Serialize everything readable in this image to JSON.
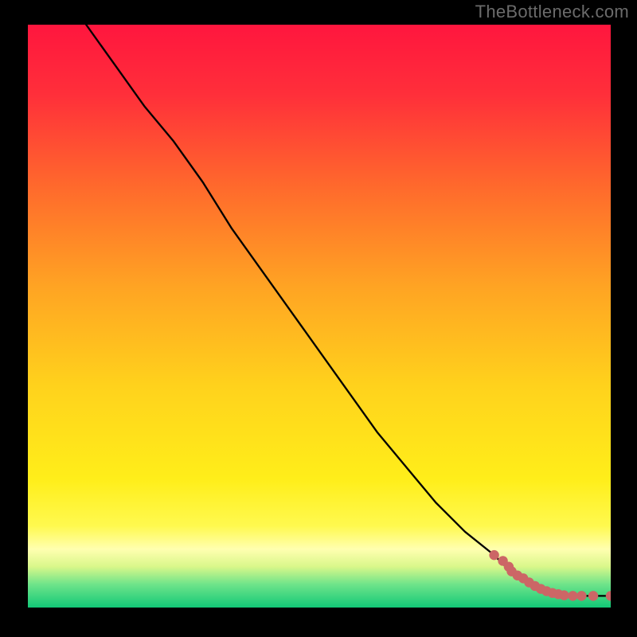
{
  "watermark": "TheBottleneck.com",
  "colors": {
    "background": "#000000",
    "watermark": "#6b6b6b",
    "curve": "#000000",
    "markers": "#cc6666",
    "gradient_top": "#ff1a3c",
    "gradient_mid1": "#ff8a1f",
    "gradient_mid2": "#ffe81a",
    "gradient_band": "#fff9a0",
    "gradient_bottom": "#17d57a"
  },
  "chart_data": {
    "type": "line",
    "title": "",
    "xlabel": "",
    "ylabel": "",
    "xlim": [
      0,
      100
    ],
    "ylim": [
      0,
      100
    ],
    "background": "rainbow-gradient (red→orange→yellow→green, top→bottom)",
    "series": [
      {
        "name": "curve",
        "style": "line",
        "x": [
          10,
          15,
          20,
          25,
          30,
          35,
          40,
          45,
          50,
          55,
          60,
          65,
          70,
          75,
          80,
          82,
          84,
          86,
          88,
          90,
          92,
          94,
          96,
          98,
          100
        ],
        "y": [
          100,
          93,
          86,
          80,
          73,
          65,
          58,
          51,
          44,
          37,
          30,
          24,
          18,
          13,
          9,
          7,
          5.5,
          4,
          3,
          2.3,
          2,
          2,
          2,
          2,
          2
        ]
      },
      {
        "name": "markers",
        "style": "scatter",
        "x": [
          80,
          81.5,
          82.5,
          83,
          84,
          85,
          86,
          87,
          88,
          89,
          90,
          91,
          92,
          93.5,
          95,
          97,
          100
        ],
        "y": [
          9,
          8,
          7,
          6.2,
          5.5,
          5,
          4.3,
          3.7,
          3.2,
          2.8,
          2.5,
          2.3,
          2.1,
          2,
          2,
          2,
          2
        ]
      }
    ],
    "notes": "Axes have no visible tick labels; chart consumes full inner square with black margins. Curve values are estimated from pixel positions on a 0-100 normalized scale."
  }
}
